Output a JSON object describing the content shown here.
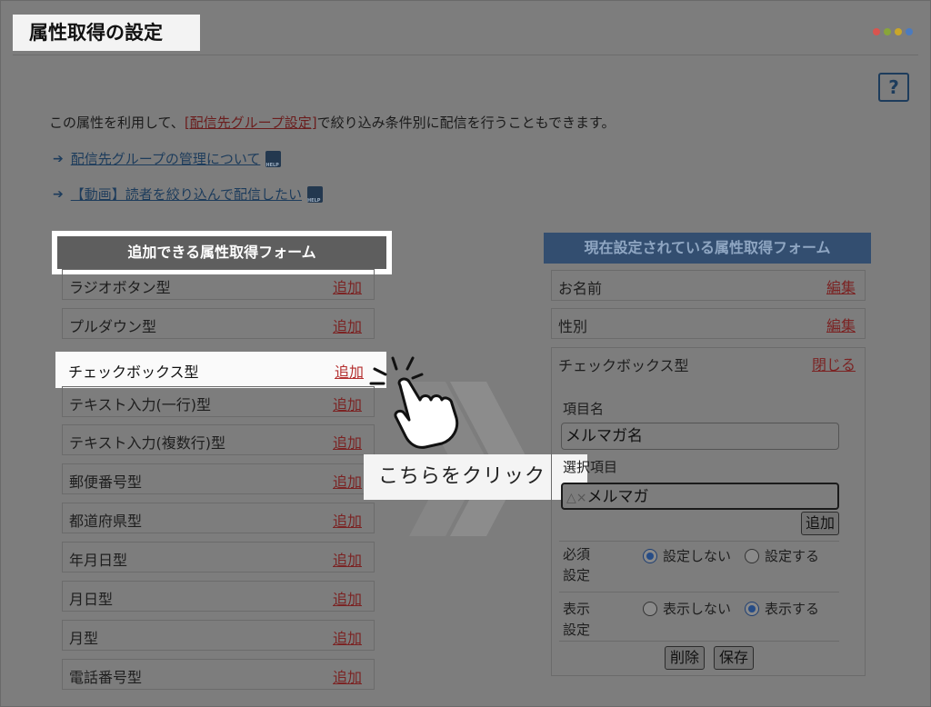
{
  "page": {
    "title": "属性取得の設定",
    "help_label": "?"
  },
  "header_dots": [
    "#d9544f",
    "#88a53a",
    "#c9a629",
    "#4b7bbf"
  ],
  "intro": {
    "before": "この属性を利用して、",
    "link": "[配信先グループ設定]",
    "after": "で絞り込み条件別に配信を行うこともできます。"
  },
  "help_links": [
    {
      "label": "配信先グループの管理について"
    },
    {
      "label": "【動画】読者を絞り込んで配信したい"
    }
  ],
  "left_panel": {
    "title": "追加できる属性取得フォーム",
    "add_label": "追加",
    "items": [
      "ラジオボタン型",
      "プルダウン型",
      "チェックボックス型",
      "テキスト入力(一行)型",
      "テキスト入力(複数行)型",
      "郵便番号型",
      "都道府県型",
      "年月日型",
      "月日型",
      "月型",
      "電話番号型"
    ]
  },
  "callout": {
    "text": "こちらをクリック"
  },
  "right_panel": {
    "title": "現在設定されている属性取得フォーム",
    "edit_label": "編集",
    "items": [
      "お名前",
      "性別"
    ],
    "expanded": {
      "label": "チェックボックス型",
      "close_label": "閉じる",
      "item_name_label": "項目名",
      "item_name_value": "メルマガ名",
      "choice_label": "選択項目",
      "choice_value": "メルマガ",
      "choice_prefix": "△×",
      "add_button": "追加",
      "required": {
        "label": "必須\n設定",
        "opt_off": "設定しない",
        "opt_on": "設定する",
        "selected": "off"
      },
      "display": {
        "label": "表示\n設定",
        "opt_off": "表示しない",
        "opt_on": "表示する",
        "selected": "on"
      },
      "delete_button": "削除",
      "save_button": "保存"
    }
  }
}
